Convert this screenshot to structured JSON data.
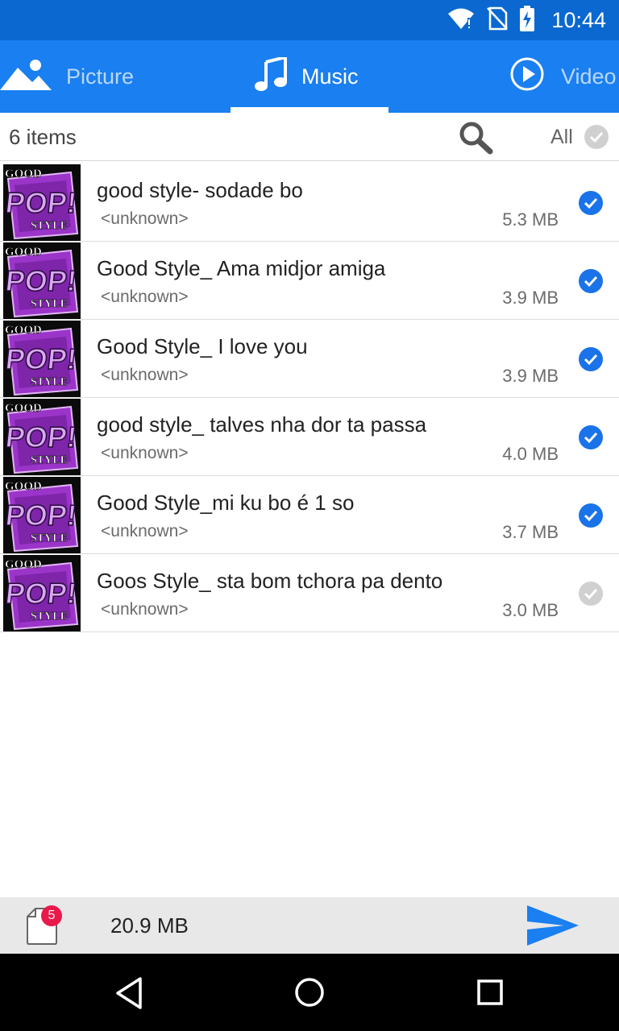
{
  "status_bar": {
    "time": "10:44"
  },
  "tabs": [
    {
      "label": "Picture",
      "icon": "picture-icon"
    },
    {
      "label": "Music",
      "icon": "music-note-icon"
    },
    {
      "label": "Video",
      "icon": "play-circle-icon"
    }
  ],
  "active_tab": "Music",
  "subheader": {
    "count_label": "6 items",
    "all_label": "All"
  },
  "items": [
    {
      "title": "good style- sodade bo",
      "artist": "<unknown>",
      "size": "5.3 MB",
      "selected": true
    },
    {
      "title": "Good Style_ Ama midjor amiga",
      "artist": "<unknown>",
      "size": "3.9 MB",
      "selected": true
    },
    {
      "title": "Good Style_ I love you",
      "artist": "<unknown>",
      "size": "3.9 MB",
      "selected": true
    },
    {
      "title": "good style_ talves nha dor ta passa",
      "artist": "<unknown>",
      "size": "4.0 MB",
      "selected": true
    },
    {
      "title": "Good Style_mi ku bo é 1 so",
      "artist": "<unknown>",
      "size": "3.7 MB",
      "selected": true
    },
    {
      "title": "Goos Style_ sta bom tchora pa dento",
      "artist": "<unknown>",
      "size": "3.0 MB",
      "selected": false
    }
  ],
  "album_art": {
    "line1": "GOOD",
    "line2": "POP!",
    "line3": "STYLE"
  },
  "bottom_bar": {
    "badge_count": "5",
    "total_size": "20.9 MB"
  },
  "colors": {
    "accent": "#1a7ff0",
    "status_bar": "#0a68d0",
    "check_selected": "#1a73e8",
    "check_unselected": "#d0d0d0",
    "badge": "#e81a4b"
  }
}
